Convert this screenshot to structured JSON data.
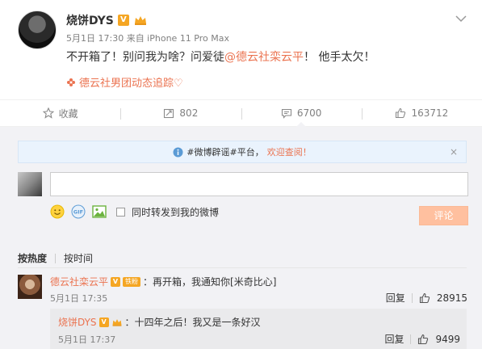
{
  "post": {
    "username": "烧饼DYS",
    "verified_badge": "V",
    "meta": "5月1日 17:30 来自 iPhone 11 Pro Max",
    "content_before": "不开箱了！别问我为啥？问爱徒",
    "mention": "@德云社栾云平",
    "content_after": "！ 他手太欠！",
    "topic": "德云社男团动态追踪♡",
    "icons": {
      "more": "chevron-down-icon",
      "crown": "crown-icon",
      "topic": "flower-icon"
    }
  },
  "actions": [
    {
      "label": "收藏",
      "icon": "star-icon"
    },
    {
      "label": "802",
      "icon": "repost-icon"
    },
    {
      "label": "6700",
      "icon": "comment-icon"
    },
    {
      "label": "163712",
      "icon": "thumbs-up-icon"
    }
  ],
  "comments_area": {
    "notice_text": "#微博辟谣#平台，",
    "notice_link": "欢迎查阅！",
    "notice_close": "×",
    "input_placeholder": "",
    "sync_label": "同时转发到我的微博",
    "submit_label": "评论",
    "sort_hot": "按热度",
    "sort_time": "按时间"
  },
  "comments": [
    {
      "user": "德云社栾云平",
      "badge": "V",
      "fan_badge": "铁粉",
      "text": "：再开箱，我通知你[米奇比心]",
      "time": "5月1日 17:35",
      "reply_label": "回复",
      "likes": "28915"
    }
  ],
  "reply": {
    "user": "烧饼DYS",
    "badge": "V",
    "text": "：十四年之后！我又是一条好汉",
    "time": "5月1日 17:37",
    "reply_label": "回复",
    "likes": "9499"
  },
  "colors": {
    "accent": "#eb7350",
    "badge": "#f5a623",
    "notice_bg": "#eaf3fd",
    "submit": "#ffc09f"
  }
}
